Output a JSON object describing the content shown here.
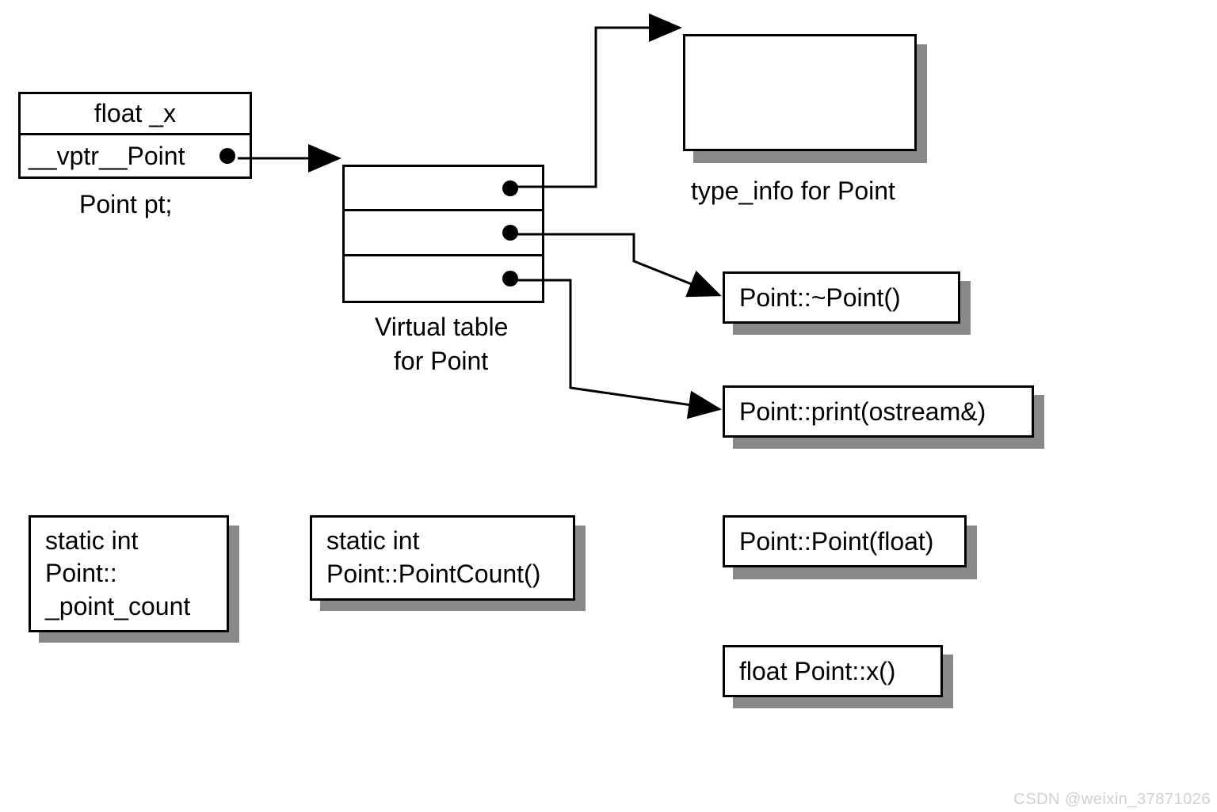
{
  "object": {
    "field1": "float _x",
    "field2": "__vptr__Point",
    "caption": "Point pt;"
  },
  "vtable": {
    "caption1": "Virtual table",
    "caption2": "for Point"
  },
  "typeinfo": {
    "caption": "type_info for Point"
  },
  "methods": {
    "dtor": "Point::~Point()",
    "print": "Point::print(ostream&)"
  },
  "statics": {
    "point_count_l1": "static int",
    "point_count_l2": "Point::",
    "point_count_l3": "_point_count",
    "pointcount_fn_l1": "static int",
    "pointcount_fn_l2": "Point::PointCount()"
  },
  "funcs": {
    "ctor": "Point::Point(float)",
    "x": "float Point::x()"
  },
  "watermark": "CSDN @weixin_37871026"
}
